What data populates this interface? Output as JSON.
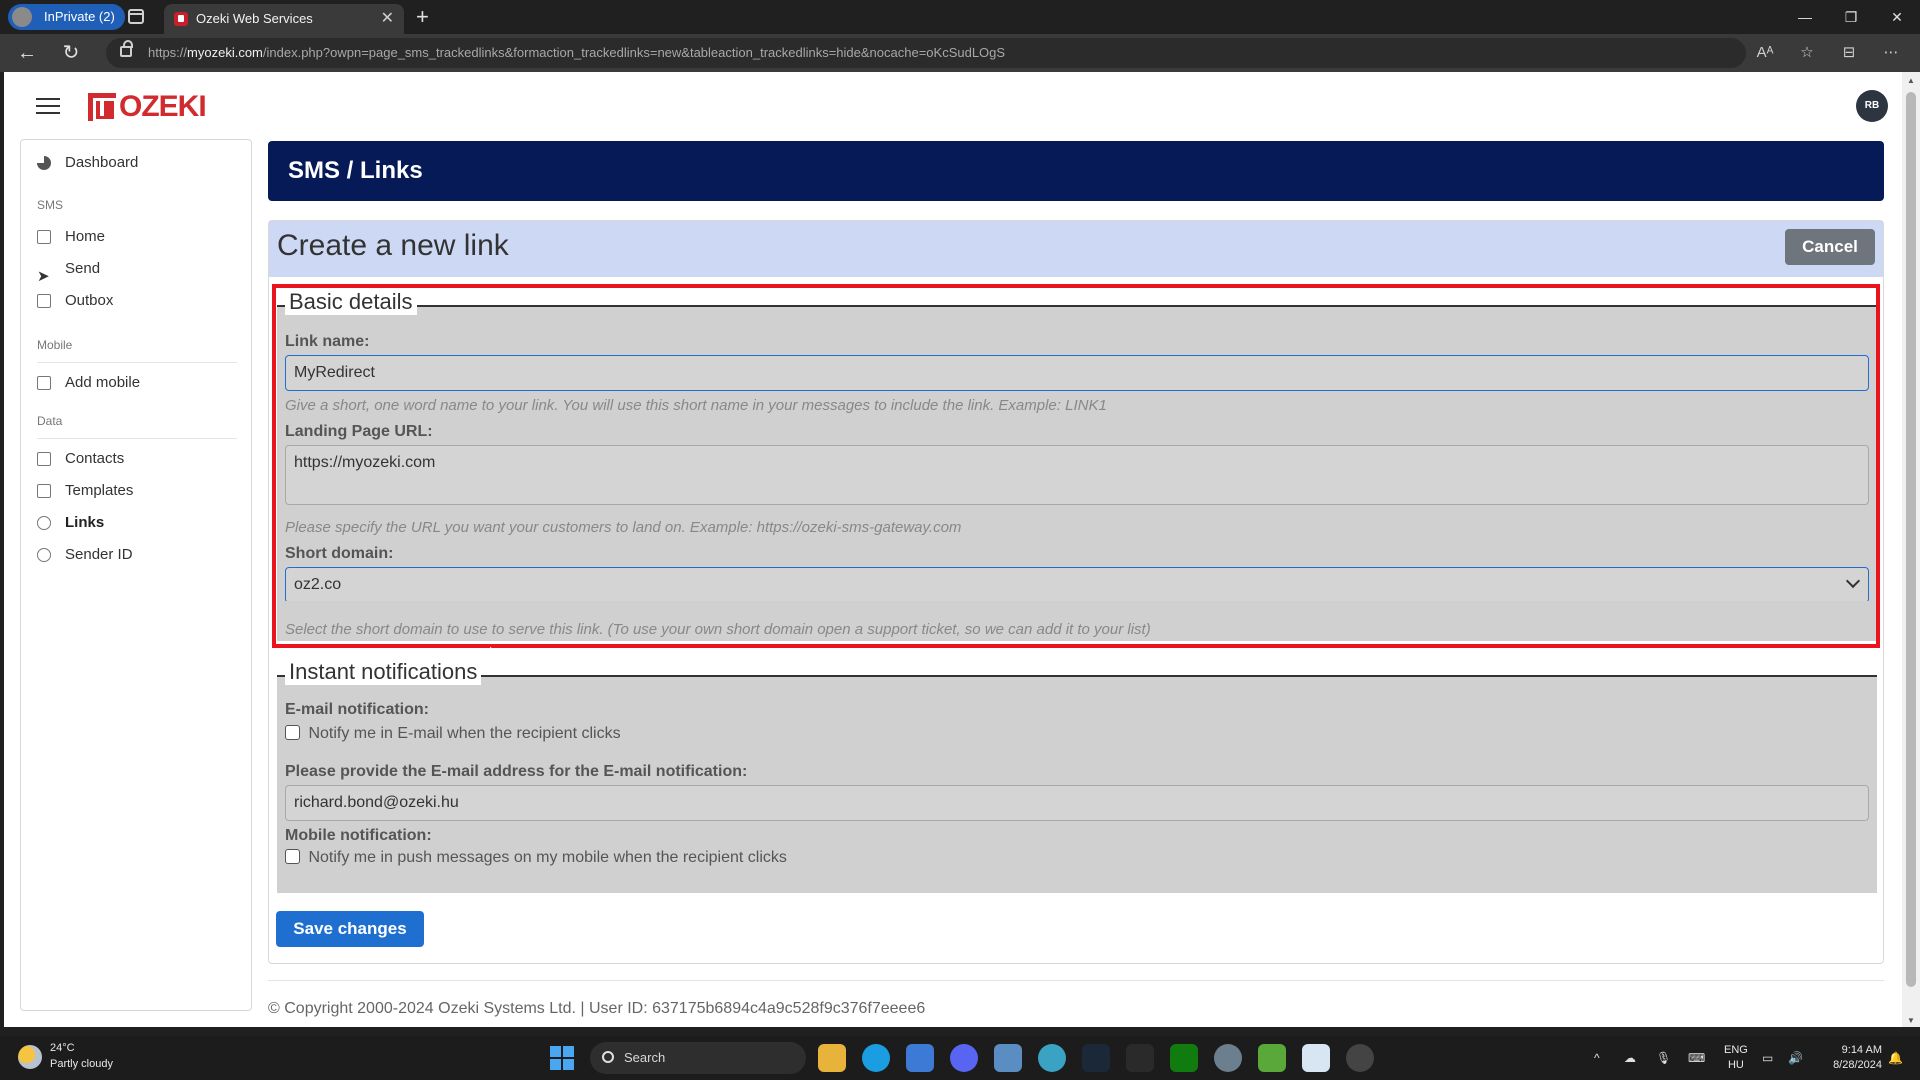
{
  "browser": {
    "inprivate_label": "InPrivate (2)",
    "tab_title": "Ozeki Web Services",
    "tab_close": "✕",
    "new_tab": "+",
    "url_prefix": "https://",
    "url_host": "myozeki.com",
    "url_path": "/index.php?owpn=page_sms_trackedlinks&formaction_trackedlinks=new&tableaction_trackedlinks=hide&nocache=oKcSudLOgS",
    "window_controls": [
      "—",
      "❐",
      "✕"
    ],
    "nav_back": "←",
    "nav_refresh": "↻",
    "addr_icons": [
      "Aᴬ",
      "☆",
      "⊟",
      "⋯"
    ]
  },
  "header": {
    "logo_text": "OZEKI",
    "user_initials": "RB"
  },
  "sidebar": {
    "dashboard": "Dashboard",
    "sections": {
      "sms": "SMS",
      "mobile": "Mobile",
      "data": "Data"
    },
    "items": {
      "home": "Home",
      "send": "Send",
      "outbox": "Outbox",
      "add_mobile": "Add mobile",
      "contacts": "Contacts",
      "templates": "Templates",
      "links": "Links",
      "sender_id": "Sender ID"
    },
    "active_item": "links"
  },
  "main": {
    "breadcrumb_title": "SMS / Links",
    "form_title": "Create a new link",
    "cancel_label": "Cancel",
    "basic_details": {
      "legend": "Basic details",
      "link_name_label": "Link name:",
      "link_name_value": "MyRedirect",
      "link_name_help": "Give a short, one word name to your link. You will use this short name in your messages to include the link. Example: LINK1",
      "landing_url_label": "Landing Page URL:",
      "landing_url_value": "https://myozeki.com",
      "landing_url_help": "Please specify the URL you want your customers to land on. Example: https://ozeki-sms-gateway.com",
      "short_domain_label": "Short domain:",
      "short_domain_value": "oz2.co",
      "short_domain_help": "Select the short domain to use to serve this link. (To use your own short domain open a support ticket, so we can add it to your list)"
    },
    "instant_notifications": {
      "legend": "Instant notifications",
      "email_label": "E-mail notification:",
      "email_checkbox_label": "Notify me in E-mail when the recipient clicks",
      "email_checked": false,
      "email_address_label": "Please provide the E-mail address for the E-mail notification:",
      "email_address_value": "richard.bond@ozeki.hu",
      "mobile_label": "Mobile notification:",
      "mobile_checkbox_label": "Notify me in push messages on my mobile when the recipient clicks",
      "mobile_checked": false
    },
    "save_label": "Save changes",
    "footer_text": "© Copyright 2000-2024 Ozeki Systems Ltd. | User ID: 637175b6894c4a9c528f9c376f7eeee6"
  },
  "taskbar": {
    "weather_temp": "24°C",
    "weather_desc": "Partly cloudy",
    "search_label": "Search",
    "lang_line1": "ENG",
    "lang_line2": "HU",
    "time": "9:14 AM",
    "date": "8/28/2024"
  },
  "colors": {
    "header_bg": "#071a58",
    "form_head_bg": "#cdd9f4",
    "highlight_border": "#e8141e",
    "primary_button": "#1f6fd0",
    "logo_red": "#d12a2f"
  }
}
